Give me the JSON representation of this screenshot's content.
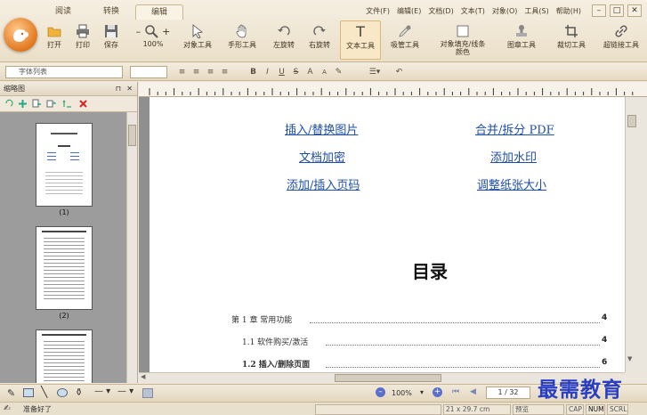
{
  "ribbon": {
    "tabs": [
      "阅读",
      "转换",
      "编辑"
    ],
    "active_tab": "编辑",
    "menu": [
      "文件(F)",
      "编辑(E)",
      "文档(D)",
      "文本(T)",
      "对象(O)",
      "工具(S)",
      "帮助(H)"
    ],
    "window_controls": [
      "–",
      "□",
      "✕"
    ],
    "tools": {
      "open": "打开",
      "print": "打印",
      "save": "保存",
      "zoom": "100%",
      "object_tool": "对象工具",
      "hand_tool": "手形工具",
      "rotate_left": "左旋转",
      "rotate_right": "右旋转",
      "text_tool": "文本工具",
      "eyedropper": "吸管工具",
      "fill_stroke": "对象填充/线条颜色",
      "shape_tool": "图章工具",
      "crop_tool": "裁切工具",
      "link_tool": "超链接工具"
    }
  },
  "format_bar": {
    "font_placeholder": "字体列表",
    "buttons": [
      "B",
      "I",
      "U",
      "S",
      "A",
      "A"
    ]
  },
  "thumbnails": {
    "title": "缩略图",
    "pages": [
      {
        "label": "(1)"
      },
      {
        "label": "(2)"
      },
      {
        "label": ""
      }
    ]
  },
  "document": {
    "links": [
      {
        "left": "插入/替换图片",
        "right": "合并/拆分 PDF"
      },
      {
        "left": "文档加密",
        "right": "添加水印"
      },
      {
        "left": "添加/插入页码",
        "right": "调整纸张大小"
      }
    ],
    "toc_title": "目录",
    "toc": [
      {
        "text": "第 1 章  常用功能",
        "page": "4"
      },
      {
        "text": "1.1 软件购买/激活",
        "page": "4"
      },
      {
        "text": "1.2 插入/删除页面",
        "page": "6"
      }
    ]
  },
  "bottom_bar": {
    "zoom": "100%",
    "page_indicator": "1 / 32"
  },
  "status": {
    "message": "准备好了",
    "page_size": "21 x 29.7 cm",
    "mode": "预览",
    "indicators": [
      "CAP",
      "NUM",
      "SCRL"
    ]
  },
  "watermark": "最需教育"
}
